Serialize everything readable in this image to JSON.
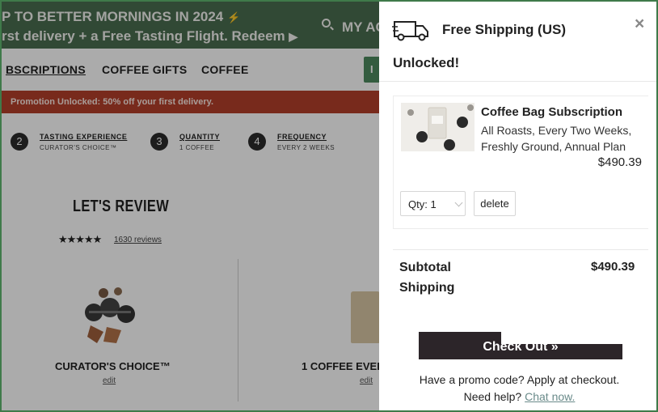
{
  "promo": {
    "line1": "P TO BETTER MORNINGS IN 2024",
    "bolt": "⚡",
    "line2": "rst delivery + a Free Tasting Flight. Redeem",
    "arrow": "▶",
    "account": "MY AC"
  },
  "nav": {
    "items": [
      "BSCRIPTIONS",
      "COFFEE GIFTS",
      "COFFEE"
    ],
    "button_text": "I"
  },
  "unlock_bar": "Promotion Unlocked: 50% off your first delivery.",
  "steps": [
    {
      "num": "2",
      "title": "TASTING EXPERIENCE",
      "value": "CURATOR'S CHOICE™"
    },
    {
      "num": "3",
      "title": "QUANTITY",
      "value": "1 COFFEE"
    },
    {
      "num": "4",
      "title": "FREQUENCY",
      "value": "EVERY 2 WEEKS"
    }
  ],
  "review": {
    "title": "LET'S REVIEW",
    "stars": "★★★★★",
    "rating": 5,
    "reviews_link": "1630 reviews",
    "products": [
      {
        "name": "CURATOR'S CHOICE™",
        "edit": "edit"
      },
      {
        "name": "1 COFFEE EVER",
        "edit": "edit"
      }
    ]
  },
  "drawer": {
    "ship_title": "Free Shipping (US)",
    "unlocked": "Unlocked!",
    "close_icon": "×",
    "item": {
      "name": "Coffee Bag Subscription",
      "desc": "All Roasts, Every Two Weeks, Freshly Ground, Annual Plan",
      "price": "$490.39",
      "qty_label": "Qty: 1",
      "delete_label": "delete"
    },
    "subtotal_label": "Subtotal",
    "subtotal_value": "$490.39",
    "shipping_label": "Shipping",
    "checkout_label": "Check Out »",
    "promo_note": "Have a promo code? Apply at checkout.",
    "help_text": "Need help?",
    "help_link": "Chat now."
  },
  "colors": {
    "promo_green": "#4a6e4f",
    "unlock_red": "#b43f2a",
    "checkout_dark": "#2c2529",
    "link_teal": "#6a8b8a"
  }
}
